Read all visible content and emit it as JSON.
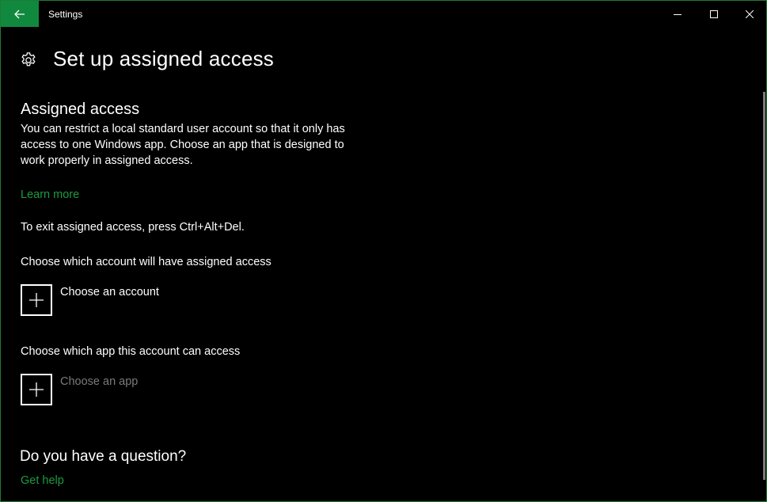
{
  "window": {
    "title": "Settings",
    "accent_color": "#10893e",
    "link_color": "#1a9c3f"
  },
  "titlebar": {
    "back_icon": "arrow-left-icon",
    "minimize_icon": "minimize-icon",
    "maximize_icon": "maximize-icon",
    "close_icon": "close-icon"
  },
  "header": {
    "icon": "gear-icon",
    "title": "Set up assigned access"
  },
  "assigned_access": {
    "heading": "Assigned access",
    "description": "You can restrict a local standard user account so that it only has access to one Windows app. Choose an app that is designed to work properly in assigned access.",
    "learn_more": "Learn more",
    "exit_hint": "To exit assigned access, press Ctrl+Alt+Del."
  },
  "account": {
    "heading": "Choose which account will have assigned access",
    "button_icon": "plus-icon",
    "button_label": "Choose an account"
  },
  "app": {
    "heading": "Choose which app this account can access",
    "button_icon": "plus-icon",
    "button_label": "Choose an app",
    "disabled": true
  },
  "help": {
    "heading": "Do you have a question?",
    "link": "Get help"
  }
}
